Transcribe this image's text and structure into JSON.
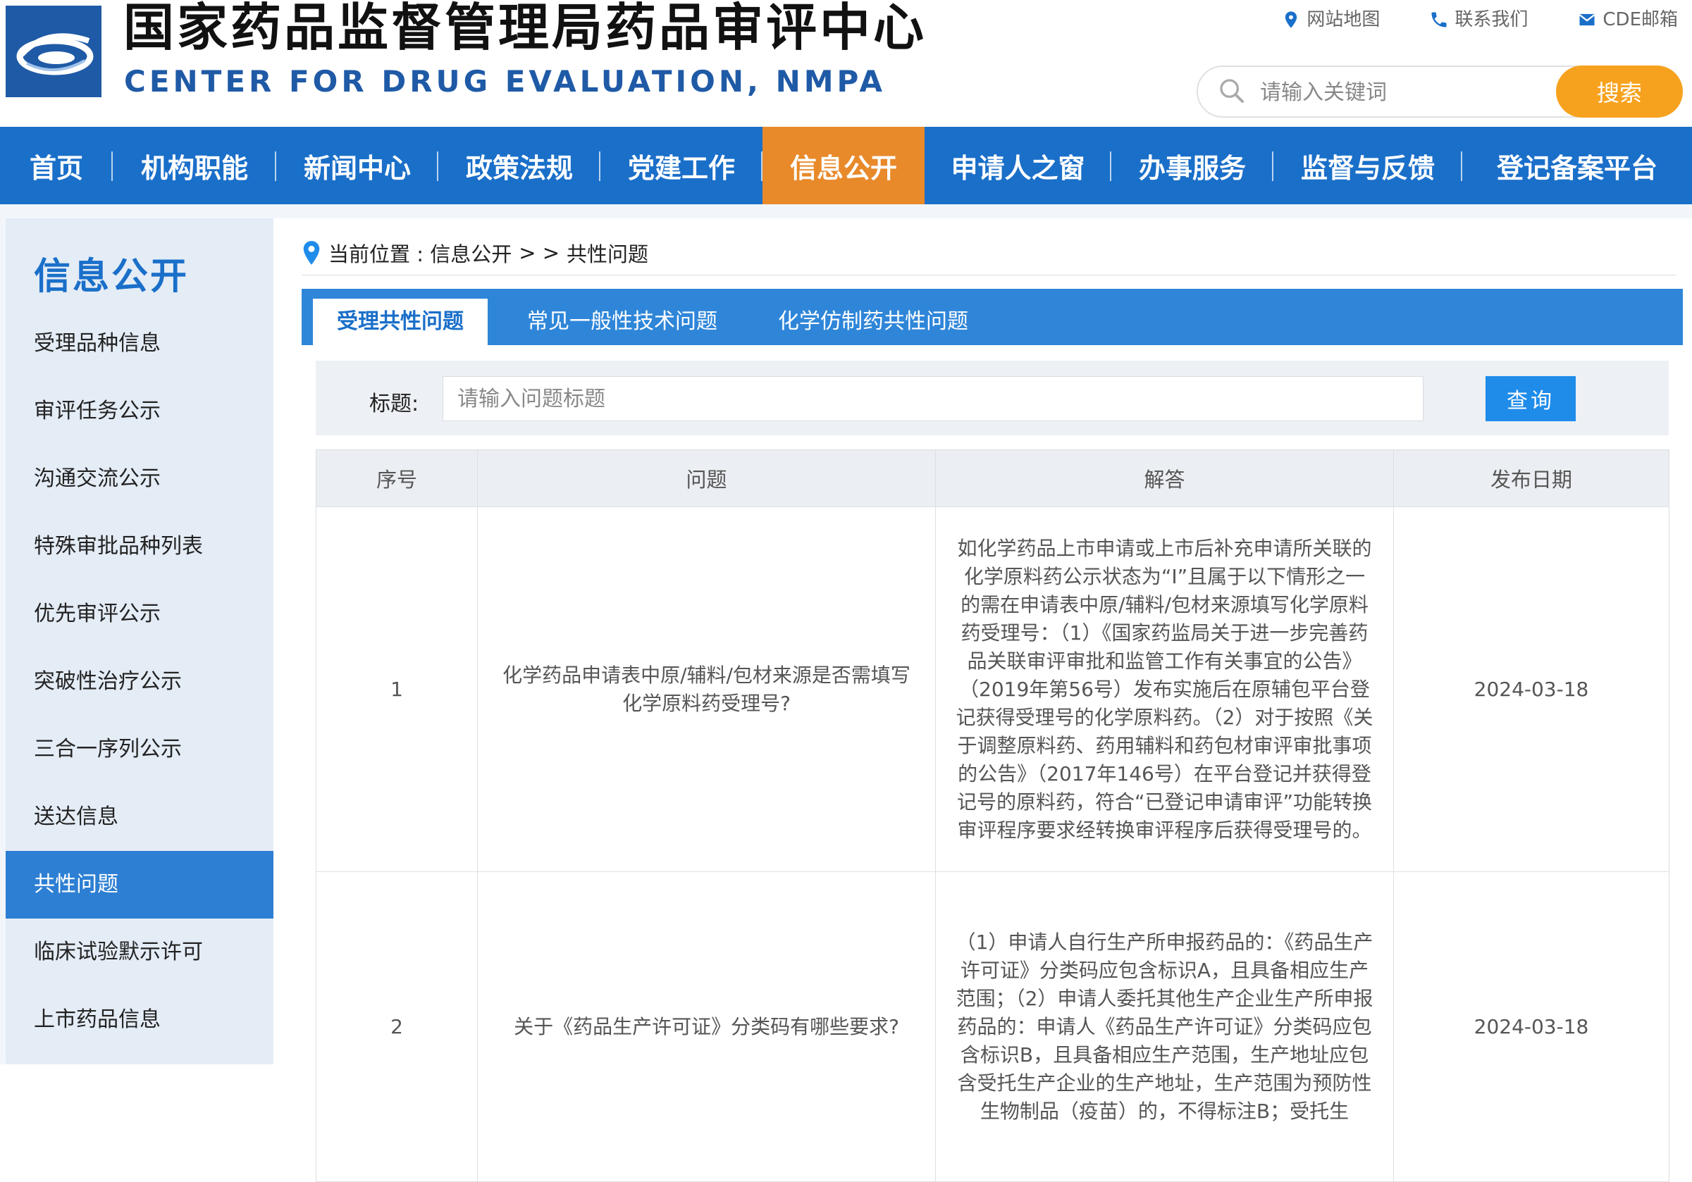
{
  "header": {
    "title_cn": "国家药品监督管理局药品审评中心",
    "title_en": "CENTER FOR DRUG EVALUATION, NMPA",
    "links": [
      {
        "label": "网站地图",
        "icon": "map-pin-icon"
      },
      {
        "label": "联系我们",
        "icon": "phone-icon"
      },
      {
        "label": "CDE邮箱",
        "icon": "mail-icon"
      }
    ],
    "search": {
      "placeholder": "请输入关键词",
      "button": "搜索"
    },
    "colors": {
      "brand_blue": "#1a6fc9",
      "accent_orange": "#f7a21e"
    }
  },
  "nav": {
    "items": [
      "首页",
      "机构职能",
      "新闻中心",
      "政策法规",
      "党建工作",
      "信息公开",
      "申请人之窗",
      "办事服务",
      "监督与反馈",
      "登记备案平台"
    ],
    "active": "信息公开"
  },
  "sidebar": {
    "title": "信息公开",
    "items": [
      "受理品种信息",
      "审评任务公示",
      "沟通交流公示",
      "特殊审批品种列表",
      "优先审评公示",
      "突破性治疗公示",
      "三合一序列公示",
      "送达信息",
      "共性问题",
      "临床试验默示许可",
      "上市药品信息"
    ],
    "active": "共性问题"
  },
  "breadcrumb": {
    "prefix": "当前位置 : 信息公开",
    "sep": "> >",
    "current": "共性问题"
  },
  "tabs": {
    "items": [
      "受理共性问题",
      "常见一般性技术问题",
      "化学仿制药共性问题"
    ],
    "active": "受理共性问题"
  },
  "filter": {
    "label": "标题:",
    "placeholder": "请输入问题标题",
    "button": "查询"
  },
  "table": {
    "headers": [
      "序号",
      "问题",
      "解答",
      "发布日期"
    ],
    "rows": [
      {
        "no": "1",
        "question": "化学药品申请表中原/辅料/包材来源是否需填写化学原料药受理号?",
        "answer": "如化学药品上市申请或上市后补充申请所关联的化学原料药公示状态为“I”且属于以下情形之一的需在申请表中原/辅料/包材来源填写化学原料药受理号：（1）《国家药监局关于进一步完善药品关联审评审批和监管工作有关事宜的公告》（2019年第56号）发布实施后在原辅包平台登记获得受理号的化学原料药。（2）对于按照《关于调整原料药、药用辅料和药包材审评审批事项的公告》（2017年146号）在平台登记并获得登记号的原料药，符合“已登记申请审评”功能转换审评程序要求经转换审评程序后获得受理号的。",
        "date": "2024-03-18"
      },
      {
        "no": "2",
        "question": "关于《药品生产许可证》分类码有哪些要求?",
        "answer": "（1）申请人自行生产所申报药品的：《药品生产许可证》分类码应包含标识A，且具备相应生产范围；（2）申请人委托其他生产企业生产所申报药品的：申请人《药品生产许可证》分类码应包含标识B，且具备相应生产范围，生产地址应包含受托生产企业的生产地址，生产范围为预防性生物制品（疫苗）的，不得标注B；受托生",
        "date": "2024-03-18"
      }
    ]
  }
}
